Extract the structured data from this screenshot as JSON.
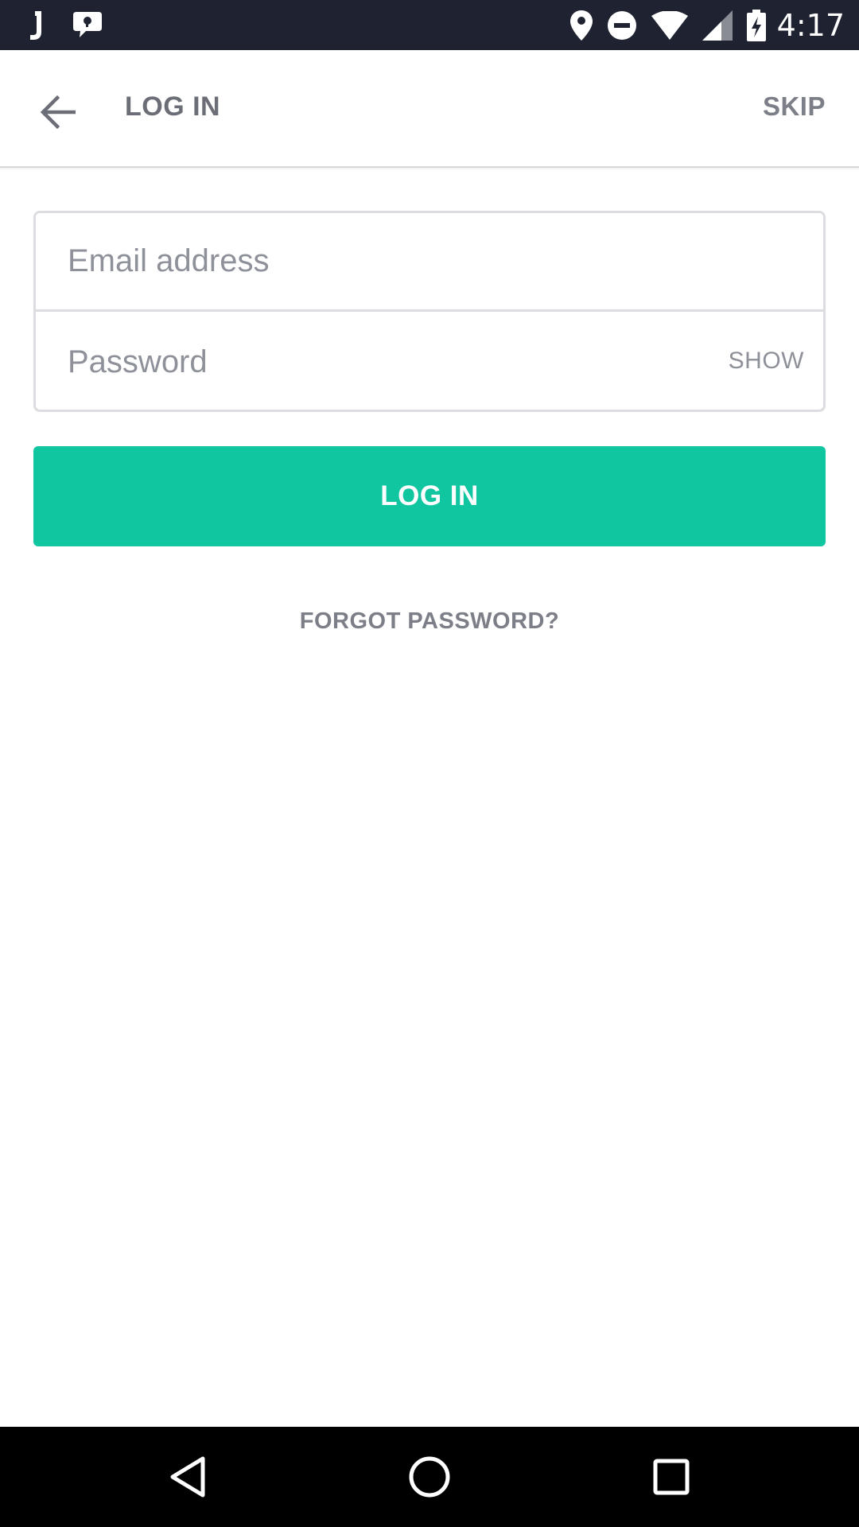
{
  "status_bar": {
    "time": "4:17",
    "icons": [
      "j-app-icon",
      "chat-bubble-icon",
      "location-pin-icon",
      "do-not-disturb-icon",
      "wifi-icon",
      "cell-signal-icon",
      "battery-charging-icon"
    ]
  },
  "app_bar": {
    "title": "LOG IN",
    "skip_label": "SKIP",
    "back_icon": "arrow-back-icon"
  },
  "form": {
    "email": {
      "value": "",
      "placeholder": "Email address"
    },
    "password": {
      "value": "",
      "placeholder": "Password",
      "show_label": "SHOW"
    }
  },
  "login_button": {
    "label": "LOG IN"
  },
  "forgot_password": {
    "label": "FORGOT PASSWORD?"
  },
  "nav_bar": {
    "icons": [
      "nav-back-icon",
      "nav-home-icon",
      "nav-recents-icon"
    ]
  },
  "colors": {
    "accent": "#0fc6a0",
    "status_bar": "#1f2230",
    "text_muted": "#7c7f87"
  }
}
